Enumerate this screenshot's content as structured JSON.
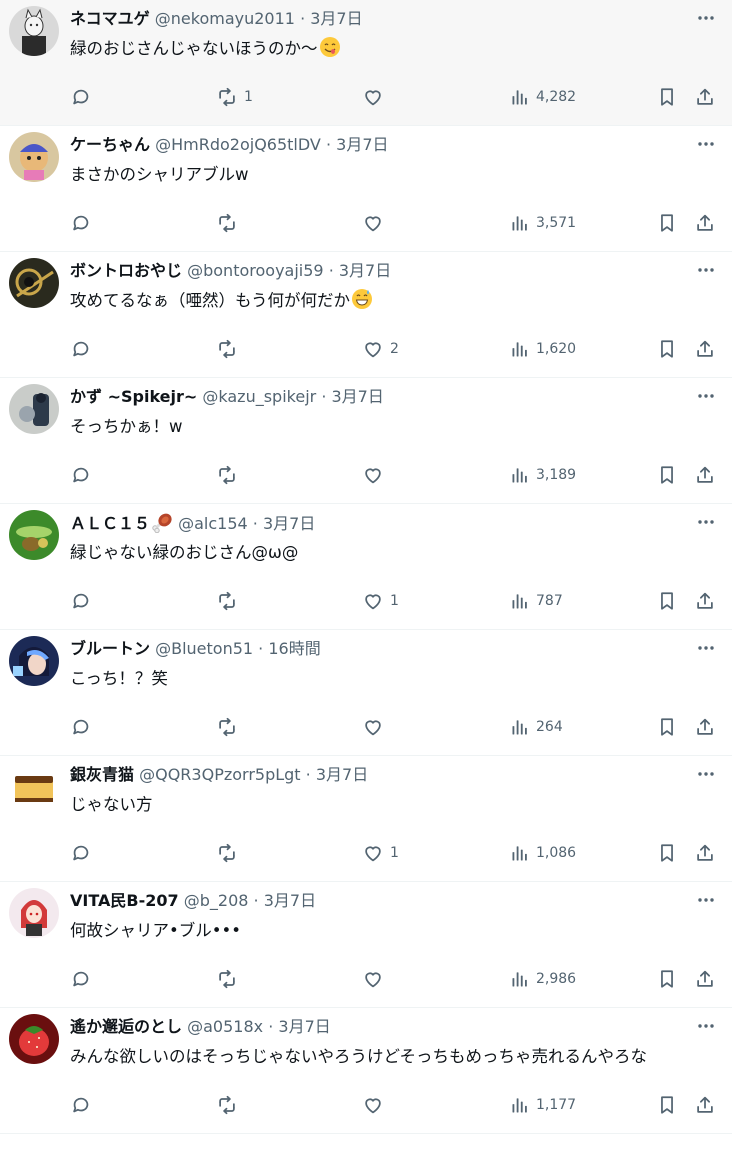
{
  "replies": [
    {
      "username": "ネコマユゲ",
      "handle": "@nekomayu2011",
      "separator": "·",
      "time": "3月7日",
      "text": "緑のおじさんじゃないほうのか～",
      "emoji": "savoring-face-emoji",
      "reply_count": "",
      "retweet_count": "1",
      "like_count": "",
      "views": "4,282",
      "avatar": {
        "bg": "#d9d9d9",
        "fg": "#2b2b2b",
        "kind": "cat-figure"
      }
    },
    {
      "username": "ケーちゃん",
      "handle": "@HmRdo2ojQ65tlDV",
      "separator": "·",
      "time": "3月7日",
      "text": "まさかのシャリアブルw",
      "emoji": "",
      "reply_count": "",
      "retweet_count": "",
      "like_count": "",
      "views": "3,571",
      "avatar": {
        "bg": "#d8c7a0",
        "fg": "#4a57c8",
        "kind": "character"
      }
    },
    {
      "username": "ボントロおやじ",
      "handle": "@bontorooyaji59",
      "separator": "·",
      "time": "3月7日",
      "text": "攻めてるなぁ（唖然）もう何が何だか",
      "emoji": "grinning-sweat-emoji",
      "reply_count": "",
      "retweet_count": "",
      "like_count": "2",
      "views": "1,620",
      "avatar": {
        "bg": "#2a2a1e",
        "fg": "#c9a64a",
        "kind": "trombone"
      }
    },
    {
      "username": "かず ~Spikejr~",
      "handle": "@kazu_spikejr",
      "separator": "·",
      "time": "3月7日",
      "text": "そっちかぁ！w",
      "emoji": "",
      "reply_count": "",
      "retweet_count": "",
      "like_count": "",
      "views": "3,189",
      "avatar": {
        "bg": "#c9ccc9",
        "fg": "#2d3a4a",
        "kind": "figure"
      }
    },
    {
      "username": "ＡＬＣ１５",
      "handle": "@alc154",
      "separator": "·",
      "time": "3月7日",
      "text": "緑じゃない緑のおじさん@ω@",
      "emoji": "",
      "name_emoji": "meat-on-bone-emoji",
      "reply_count": "",
      "retweet_count": "",
      "like_count": "1",
      "views": "787",
      "avatar": {
        "bg": "#3c8a2a",
        "fg": "#a5d36a",
        "kind": "badge"
      }
    },
    {
      "username": "ブルートン",
      "handle": "@Blueton51",
      "separator": "·",
      "time": "16時間",
      "text": "こっち！？笑",
      "emoji": "",
      "reply_count": "",
      "retweet_count": "",
      "like_count": "",
      "views": "264",
      "avatar": {
        "bg": "#1c2a56",
        "fg": "#6fa8ff",
        "kind": "anime"
      }
    },
    {
      "username": "銀灰青猫",
      "handle": "@QQR3QPzorr5pLgt",
      "separator": "·",
      "time": "3月7日",
      "text": "じゃない方",
      "emoji": "",
      "reply_count": "",
      "retweet_count": "",
      "like_count": "1",
      "views": "1,086",
      "avatar": {
        "bg": "#ffffff",
        "fg": "#c88a2a",
        "kind": "cake"
      }
    },
    {
      "username": "VITA民B-207",
      "handle": "@b_208",
      "separator": "·",
      "time": "3月7日",
      "text": "何故シャリア•ブル•••",
      "emoji": "",
      "reply_count": "",
      "retweet_count": "",
      "like_count": "",
      "views": "2,986",
      "avatar": {
        "bg": "#f3e9ee",
        "fg": "#d23a3a",
        "kind": "redhair"
      }
    },
    {
      "username": "遙か邂逅のとし",
      "handle": "@a0518x",
      "separator": "·",
      "time": "3月7日",
      "text": "みんな欲しいのはそっちじゃないやろうけどそっちもめっちゃ売れるんやろな",
      "emoji": "",
      "reply_count": "",
      "retweet_count": "",
      "like_count": "",
      "views": "1,177",
      "avatar": {
        "bg": "#6a0f0f",
        "fg": "#e33a3a",
        "kind": "strawberry"
      }
    }
  ]
}
